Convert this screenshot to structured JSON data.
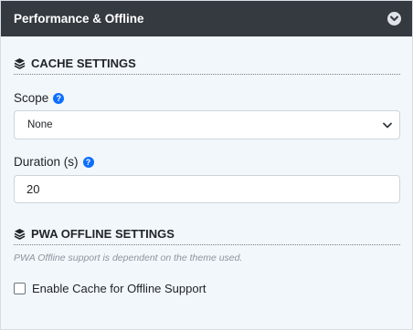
{
  "panel": {
    "title": "Performance & Offline",
    "collapse_icon": "chevron-down-circle-icon"
  },
  "cache_section": {
    "heading": "CACHE SETTINGS",
    "icon": "layers-icon",
    "scope": {
      "label": "Scope",
      "help_icon": "question-circle-icon",
      "selected": "None"
    },
    "duration": {
      "label": "Duration (s)",
      "help_icon": "question-circle-icon",
      "value": "20"
    }
  },
  "pwa_section": {
    "heading": "PWA OFFLINE SETTINGS",
    "icon": "layers-icon",
    "note": "PWA Offline support is dependent on the theme used.",
    "checkbox_label": "Enable Cache for Offline Support",
    "checked": false
  },
  "colors": {
    "header_bg": "#343a40",
    "panel_bg": "#f2f7fc",
    "help_icon": "#0d6efd"
  }
}
